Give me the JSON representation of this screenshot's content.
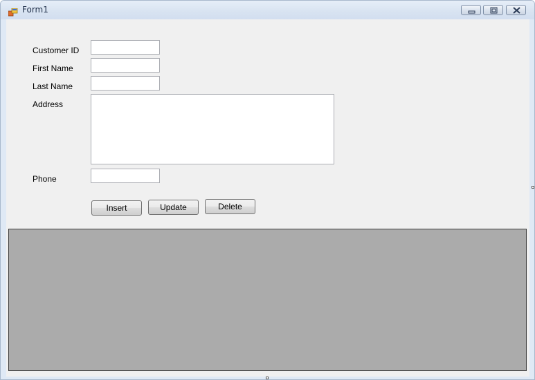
{
  "window": {
    "title": "Form1",
    "icons": {
      "app": "windows-form-icon",
      "minimize": "minimize-icon",
      "maximize": "restore-icon",
      "close": "close-icon"
    },
    "colors": {
      "titlebar": "#d8e3f1",
      "client": "#f0f0f0",
      "grid": "#ababab"
    }
  },
  "form": {
    "customer_id_label": "Customer ID",
    "customer_id_value": "",
    "first_name_label": "First Name",
    "first_name_value": "",
    "last_name_label": "Last Name",
    "last_name_value": "",
    "address_label": "Address",
    "address_value": "",
    "phone_label": "Phone",
    "phone_value": ""
  },
  "buttons": {
    "insert": "Insert",
    "update": "Update",
    "delete": "Delete"
  }
}
